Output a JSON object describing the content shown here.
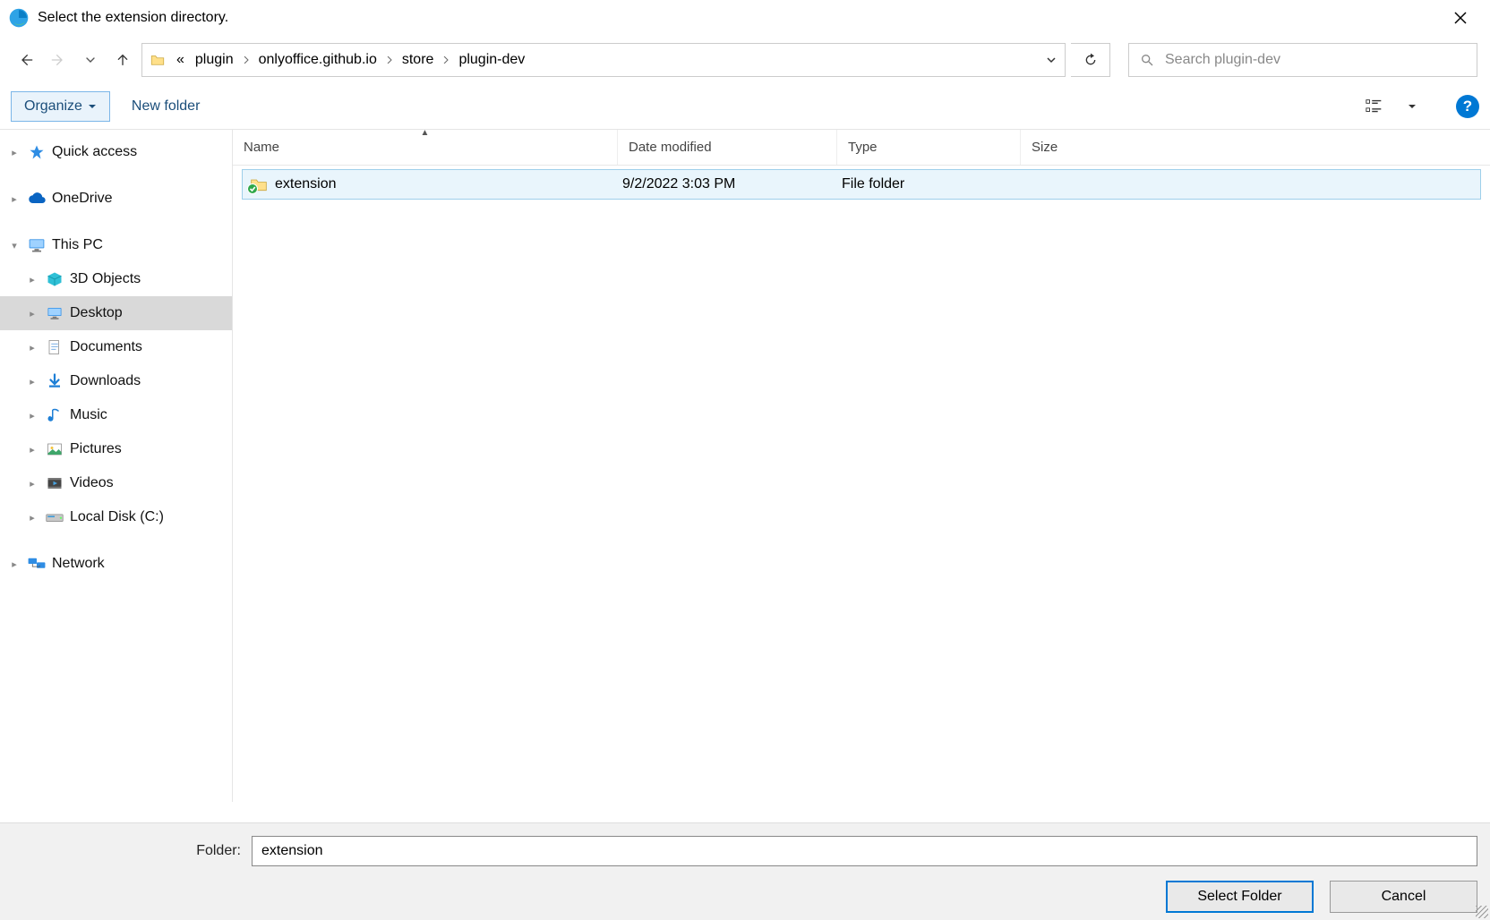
{
  "dialog": {
    "title": "Select the extension directory."
  },
  "breadcrumb": {
    "prefix": "«",
    "items": [
      "plugin",
      "onlyoffice.github.io",
      "store",
      "plugin-dev"
    ]
  },
  "search": {
    "placeholder": "Search plugin-dev"
  },
  "toolbar": {
    "organize": "Organize",
    "new_folder": "New folder"
  },
  "tree": {
    "quick_access": "Quick access",
    "onedrive": "OneDrive",
    "this_pc": "This PC",
    "this_pc_children": [
      "3D Objects",
      "Desktop",
      "Documents",
      "Downloads",
      "Music",
      "Pictures",
      "Videos",
      "Local Disk (C:)"
    ],
    "selected_child": "Desktop",
    "network": "Network"
  },
  "columns": {
    "name": "Name",
    "date": "Date modified",
    "type": "Type",
    "size": "Size"
  },
  "rows": [
    {
      "name": "extension",
      "date": "9/2/2022 3:03 PM",
      "type": "File folder",
      "size": ""
    }
  ],
  "footer": {
    "folder_label": "Folder:",
    "folder_value": "extension",
    "select_folder": "Select Folder",
    "cancel": "Cancel"
  }
}
